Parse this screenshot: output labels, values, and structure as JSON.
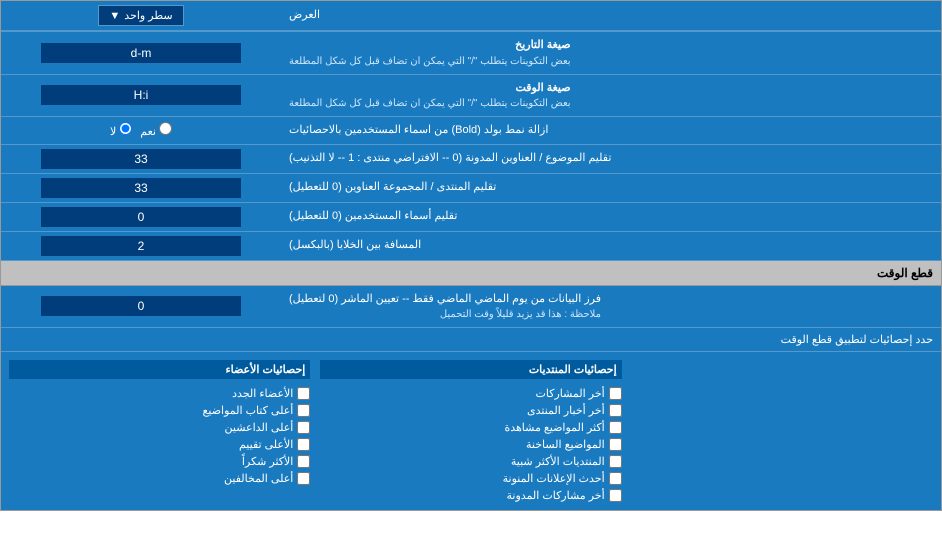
{
  "header": {
    "label_left": "العرض",
    "label_right": "سطر واحد",
    "dropdown_icon": "▼"
  },
  "rows": [
    {
      "id": "date_format",
      "label_main": "صيغة التاريخ",
      "label_sub": "بعض التكوينات يتطلب \"/\" التي يمكن ان تضاف قبل كل شكل المطلعة",
      "value": "d-m"
    },
    {
      "id": "time_format",
      "label_main": "صيغة الوقت",
      "label_sub": "بعض التكوينات يتطلب \"/\" التي يمكن ان تضاف قبل كل شكل المطلعة",
      "value": "H:i"
    },
    {
      "id": "bold_remove",
      "label": "ازالة نمط بولد (Bold) من اسماء المستخدمين بالاحصائيات",
      "radio_yes": "نعم",
      "radio_no": "لا",
      "selected": "no"
    },
    {
      "id": "topics_limit",
      "label": "تقليم الموضوع / العناوين المدونة (0 -- الافتراضي منتدى : 1 -- لا التذنيب)",
      "value": "33"
    },
    {
      "id": "forum_limit",
      "label": "تقليم المنتدى / المجموعة العناوين (0 للتعطيل)",
      "value": "33"
    },
    {
      "id": "usernames_limit",
      "label": "تقليم أسماء المستخدمين (0 للتعطيل)",
      "value": "0"
    },
    {
      "id": "cells_gap",
      "label": "المسافة بين الخلايا (بالبكسل)",
      "value": "2"
    }
  ],
  "section_time": {
    "title": "قطع الوقت",
    "row_label_main": "فرز البيانات من يوم الماضي الماضي فقط -- تعيين الماشر (0 لتعطيل)",
    "row_label_sub": "ملاحظة : هذا قد يزيد قليلاً وقت التحميل",
    "row_value": "0"
  },
  "limit_row": {
    "label": "حدد إحصائيات لتطبيق قطع الوقت"
  },
  "checkboxes": {
    "col1_header": "إحصائيات المنتديات",
    "col1_items": [
      "أخر المشاركات",
      "أخر أخبار المنتدى",
      "أكثر المواضيع مشاهدة",
      "المواضيع الساخنة",
      "المنتديات الأكثر شبية",
      "أحدث الإعلانات المنونة",
      "أخر مشاركات المدونة"
    ],
    "col2_header": "إحصائيات الأعضاء",
    "col2_items": [
      "الأعضاء الجدد",
      "أعلى كتاب المواضيع",
      "أعلى الداعشين",
      "الأعلى تقييم",
      "الأكثر شكراً",
      "أعلى المخالفين"
    ]
  }
}
